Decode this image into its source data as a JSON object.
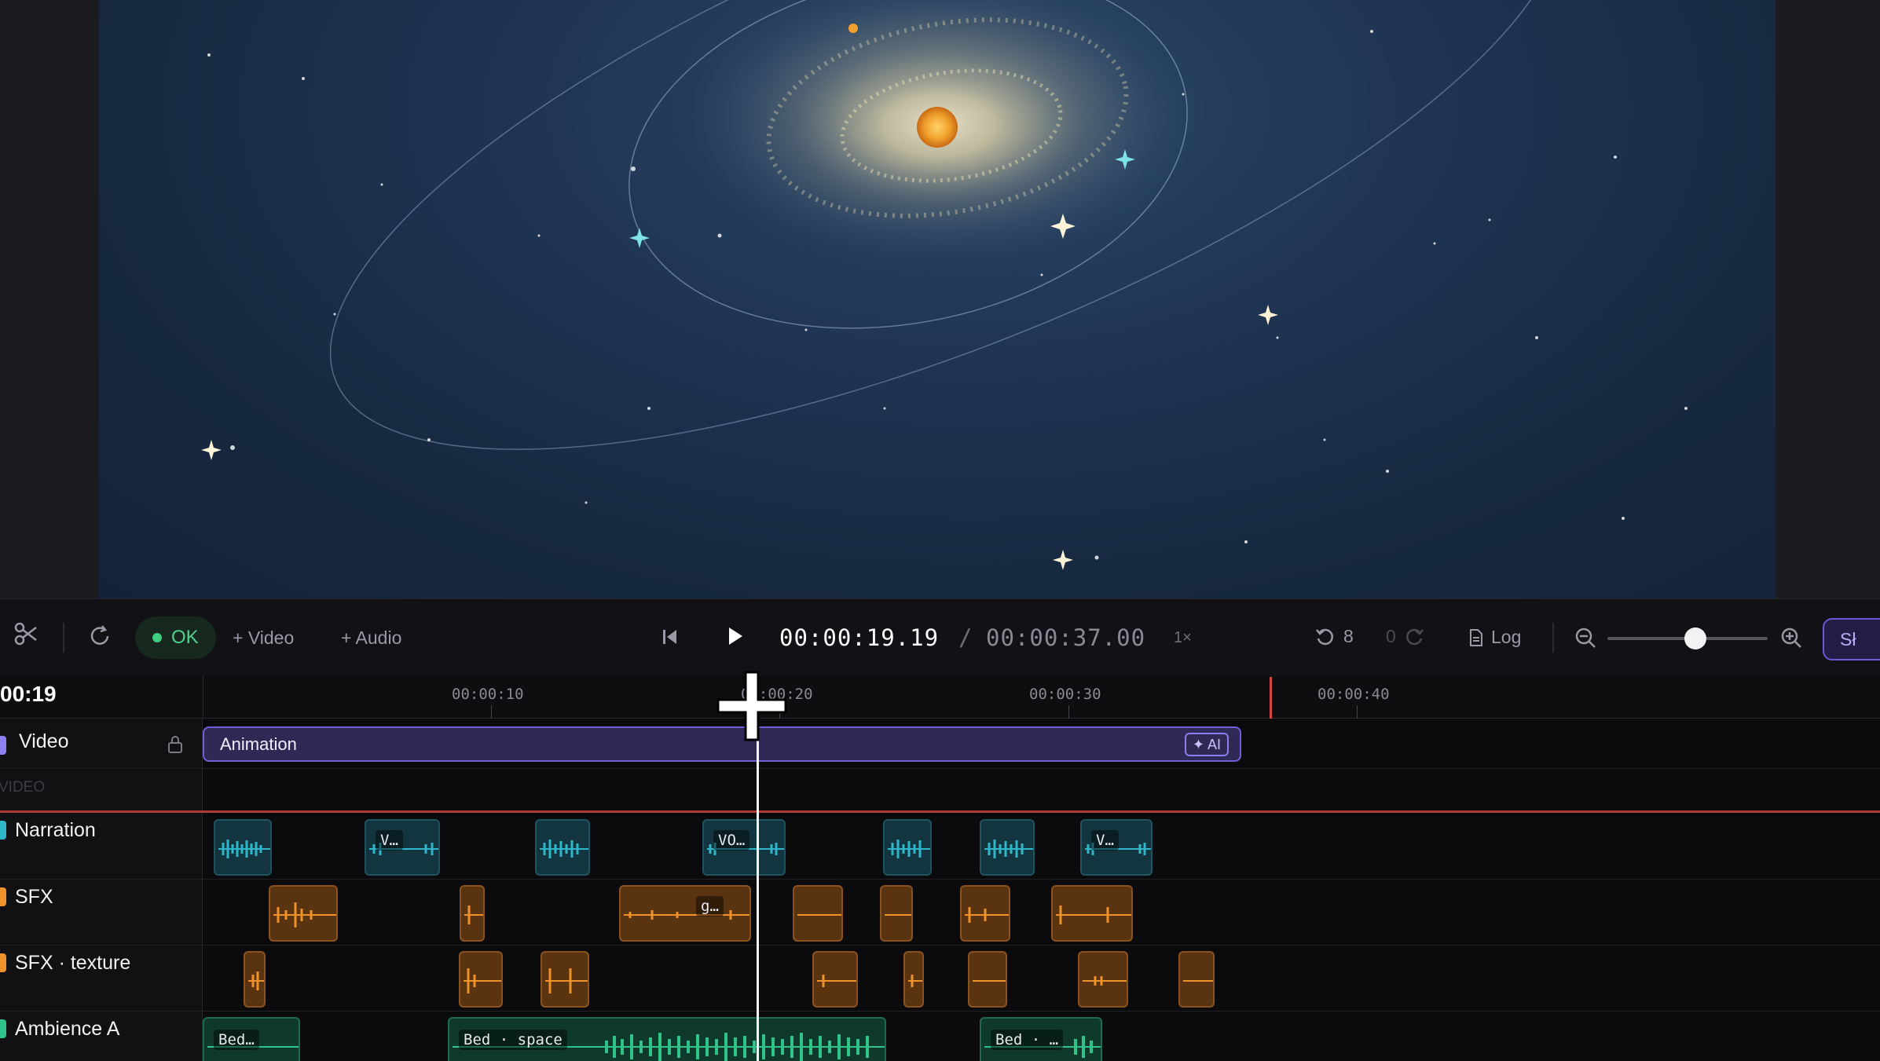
{
  "toolbar": {
    "status": "OK",
    "add_video": "+ Video",
    "add_audio": "+ Audio",
    "current_time": "00:00:19.19",
    "separator": "/",
    "total_time": "00:00:37.00",
    "speed": "1×",
    "undo_count": "8",
    "redo_count": "0",
    "log_label": "Log",
    "share_label": "Sł",
    "zoom_level": 0.55
  },
  "ruler": {
    "current_time_short": "00:19",
    "labels": [
      "00:00:10",
      "00:00:20",
      "00:00:30",
      "00:00:40"
    ]
  },
  "tracks": {
    "video": {
      "label": "Video",
      "section_label": "VIDEO",
      "clip_label": "Animation",
      "ai_badge": "✦ AI"
    },
    "narration": {
      "label": "Narration",
      "clip_texts": [
        "V…",
        "VO…",
        "V…"
      ]
    },
    "sfx": {
      "label": "SFX",
      "clip_texts": [
        "g…"
      ]
    },
    "sfx_texture": {
      "label": "SFX · texture"
    },
    "ambience": {
      "label": "Ambience A",
      "clip_texts": [
        "Bed…",
        "Bed · space",
        "Bed · …"
      ]
    }
  },
  "colors": {
    "accent": "#6d60d9",
    "status_ok": "#3fd07f",
    "narration": "#2fb7c9",
    "sfx": "#f0922a",
    "ambience": "#2fc38a",
    "end_marker": "#d8453e"
  },
  "icons": {
    "cut": "scissors-icon",
    "refresh": "refresh-icon",
    "skip_back": "skip-back-icon",
    "play": "play-icon",
    "undo": "undo-icon",
    "redo": "redo-icon",
    "log": "document-icon",
    "zoom_out": "zoom-out-icon",
    "zoom_in": "zoom-in-icon",
    "lock": "lock-icon"
  }
}
